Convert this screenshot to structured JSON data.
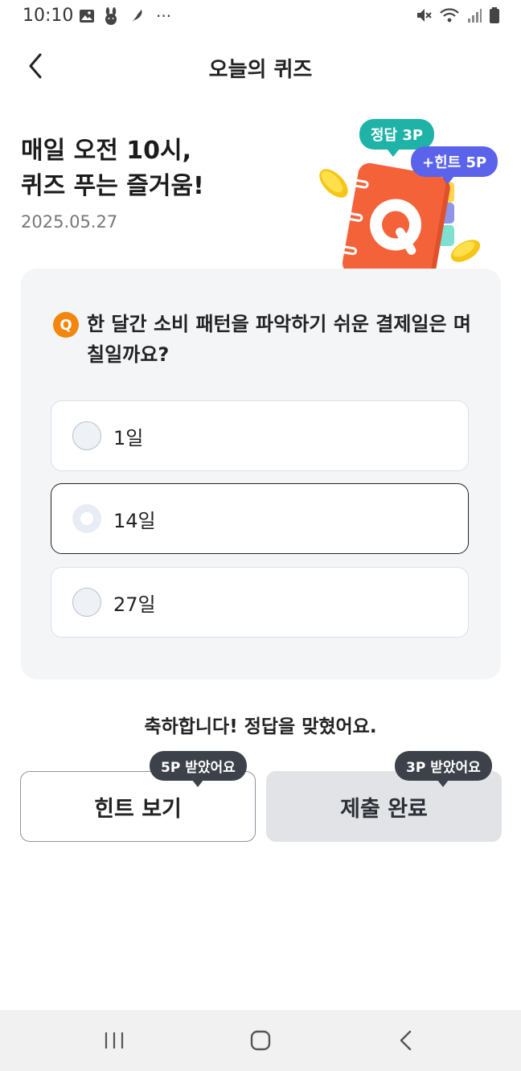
{
  "status_bar": {
    "time": "10:10",
    "overflow": "···"
  },
  "header": {
    "title": "오늘의 퀴즈"
  },
  "hero": {
    "title_line1": "매일 오전 10시,",
    "title_line2": "퀴즈 푸는 즐거움!",
    "date": "2025.05.27",
    "bubble_answer": "정답 3P",
    "bubble_hint": "+힌트 5P"
  },
  "quiz": {
    "badge": "Q",
    "question": "한 달간 소비 패턴을 파악하기 쉬운 결제일은 며칠일까요?",
    "options": [
      {
        "label": "1일",
        "selected": false
      },
      {
        "label": "14일",
        "selected": true
      },
      {
        "label": "27일",
        "selected": false
      }
    ]
  },
  "result_message": "축하합니다! 정답을 맞혔어요.",
  "actions": {
    "hint_label": "힌트 보기",
    "hint_tooltip": "5P 받았어요",
    "submit_label": "제출 완료",
    "submit_tooltip": "3P 받았어요"
  },
  "colors": {
    "answer_bubble": "#1fb3a7",
    "hint_bubble": "#5b63ea",
    "q_badge": "#f3860f",
    "notebook": "#f4623a"
  }
}
